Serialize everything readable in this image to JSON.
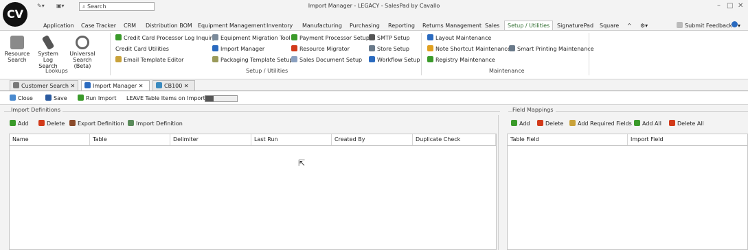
{
  "window": {
    "title": "Import Manager - LEGACY - SalesPad by Cavallo",
    "search_placeholder": "Search",
    "minimize": "–",
    "maximize": "□",
    "close": "✕",
    "logo_text": "CV"
  },
  "ribbon_tabs": [
    "Application",
    "Case Tracker",
    "CRM",
    "Distribution BOM",
    "Equipment Management",
    "Inventory",
    "Manufacturing",
    "Purchasing",
    "Reporting",
    "Returns Management",
    "Sales",
    "Setup / Utilities",
    "SignaturePad",
    "Square"
  ],
  "ribbon_right": {
    "collapse": "^",
    "submit_feedback": "Submit Feedback"
  },
  "lookups": {
    "label": "Lookups",
    "resource_search": "Resource Search",
    "system_log_search": "System Log Search",
    "universal_search": "Universal Search (Beta)"
  },
  "setup": {
    "label": "Setup / Utilities",
    "items": [
      "Credit Card Processor Log Inquiry",
      "Credit Card Utilities",
      "Email Template Editor",
      "Equipment Migration Tool",
      "Import Manager",
      "Packaging Template Setup",
      "Payment Processor Setup",
      "Resource Migrator",
      "Sales Document Setup",
      "SMTP Setup",
      "Store Setup",
      "Workflow Setup"
    ]
  },
  "maintenance": {
    "label": "Maintenance",
    "items": [
      "Layout Maintenance",
      "Note Shortcut Maintenance",
      "Registry Maintenance",
      "Smart Printing Maintenance"
    ]
  },
  "doc_tabs": [
    "Customer Search",
    "Import Manager",
    "CB100"
  ],
  "toolbar": {
    "close": "Close",
    "save": "Save",
    "run_import": "Run Import",
    "leave_table_items": "LEAVE Table Items on Import"
  },
  "import_definitions": {
    "label": "Import Definitions",
    "add": "Add",
    "delete": "Delete",
    "export": "Export Definition",
    "import": "Import Definition",
    "columns": [
      "Name",
      "Table",
      "Delimiter",
      "Last Run",
      "Created By",
      "Duplicate Check"
    ]
  },
  "field_mappings": {
    "label": "Field Mappings",
    "add": "Add",
    "delete": "Delete",
    "add_required": "Add Required Fields",
    "add_all": "Add All",
    "delete_all": "Delete All",
    "columns": [
      "Table Field",
      "Import Field"
    ]
  },
  "colors": {
    "accent": "#2a6a2a",
    "green_icon": "#3a9a2a",
    "red_icon": "#d23a1a",
    "blue_icon": "#2a6abf"
  }
}
